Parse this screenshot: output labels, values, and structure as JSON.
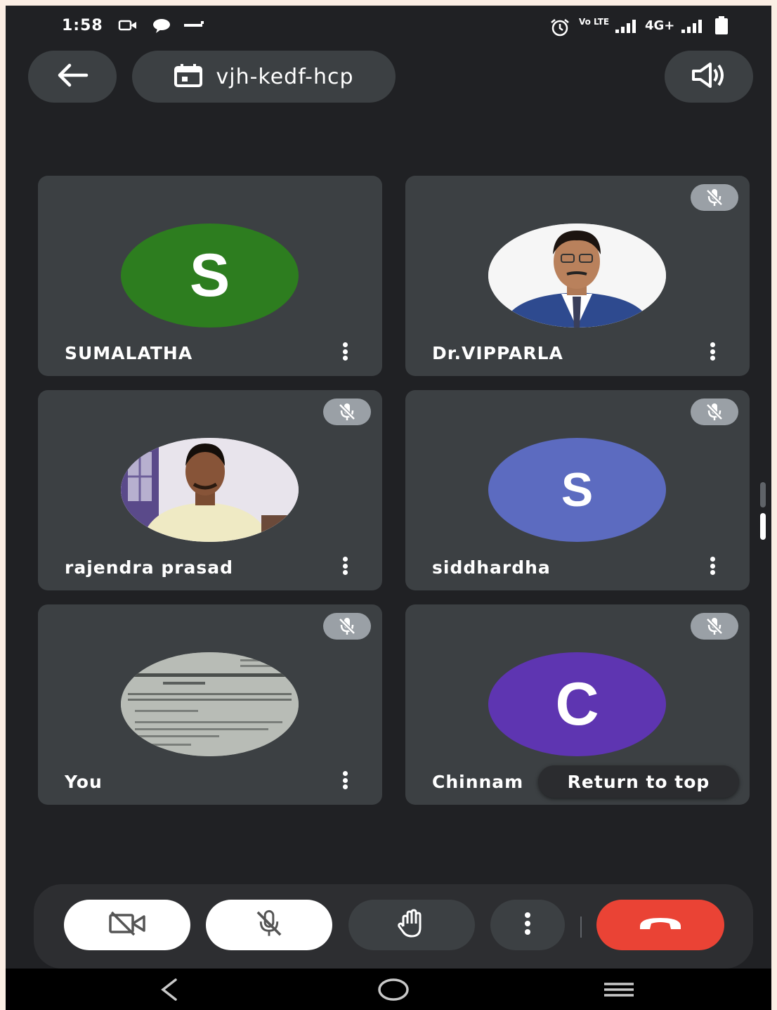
{
  "status_bar": {
    "time": "1:58",
    "network": "4G+",
    "volte_label": "Vo LTE"
  },
  "top_bar": {
    "meeting_code": "vjh-kedf-hcp"
  },
  "participants": [
    {
      "name": "SUMALATHA",
      "avatar_type": "letter",
      "avatar_letter": "S",
      "avatar_color": "#2d7d1f",
      "muted": false
    },
    {
      "name": "Dr.VIPPARLA",
      "avatar_type": "photo",
      "muted": true
    },
    {
      "name": "rajendra prasad",
      "avatar_type": "photo",
      "muted": true
    },
    {
      "name": "siddhardha",
      "avatar_type": "letter",
      "avatar_letter": "S",
      "avatar_color": "#5c6bc0",
      "muted": true
    },
    {
      "name": "You",
      "avatar_type": "photo",
      "muted": true
    },
    {
      "name": "Chinnam",
      "avatar_type": "letter",
      "avatar_letter": "C",
      "avatar_color": "#5e35b1",
      "muted": true
    }
  ],
  "return_to_top_label": "Return to top",
  "controls": {
    "camera_icon": "video-off-icon",
    "mic_icon": "mic-off-icon",
    "hand_icon": "raise-hand-icon",
    "more_icon": "more-vert-icon",
    "end_call_icon": "call-end-icon",
    "end_call_color": "#ea4335"
  },
  "nav": {
    "back_icon": "nav-back-icon",
    "home_icon": "nav-home-icon",
    "recents_icon": "nav-recents-icon"
  }
}
